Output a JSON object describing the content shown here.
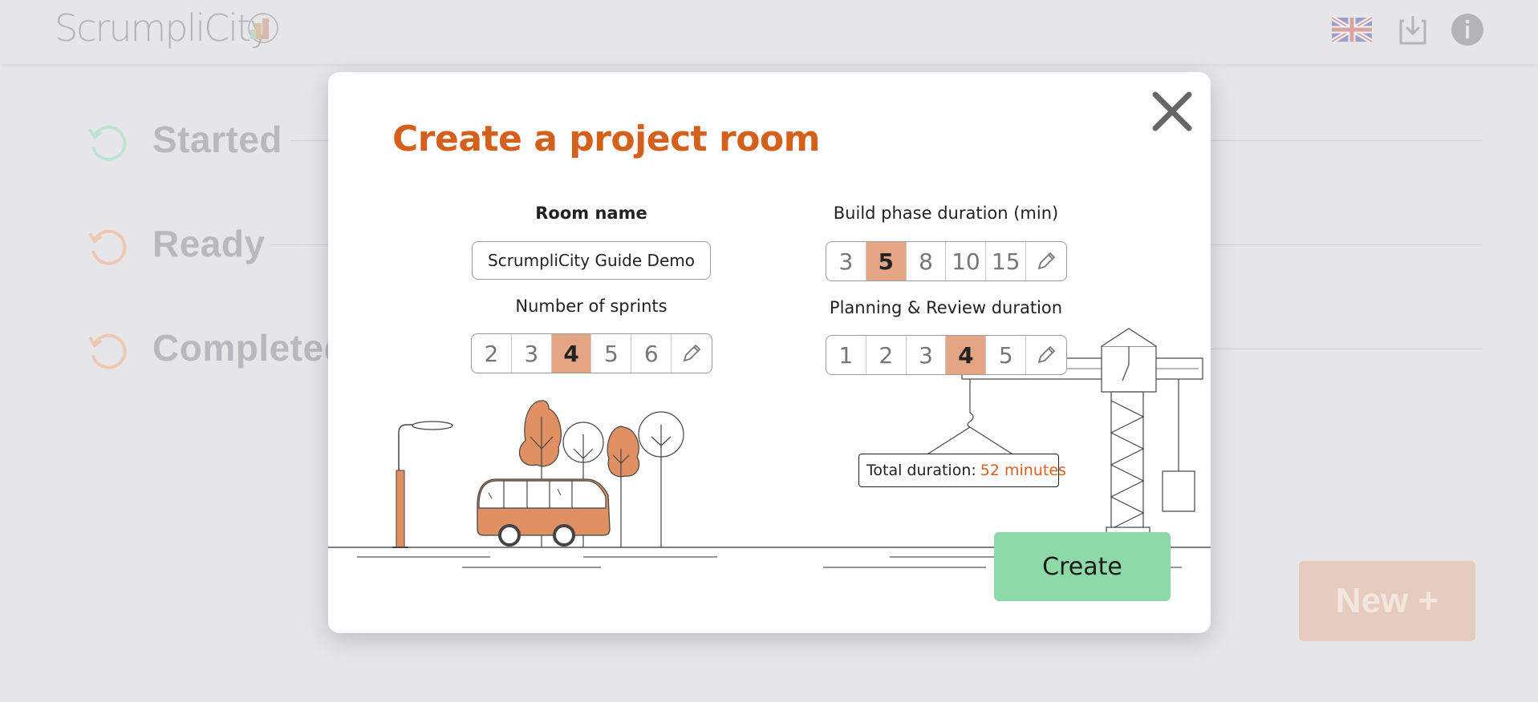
{
  "app": {
    "logo_text": "ScrumpliCity"
  },
  "header": {
    "icons": [
      "language-flag-icon",
      "download-icon",
      "info-icon"
    ]
  },
  "statuses": [
    {
      "label": "Started",
      "color": "#bfe3d2"
    },
    {
      "label": "Ready",
      "color": "#edc9b4"
    },
    {
      "label": "Completed",
      "color": "#edc9b4"
    }
  ],
  "new_button": {
    "label": "New +"
  },
  "modal": {
    "title": "Create a project room",
    "room_name": {
      "label": "Room name",
      "value": "ScrumpliCity Guide Demo"
    },
    "sprints": {
      "label": "Number of sprints",
      "options": [
        "2",
        "3",
        "4",
        "5",
        "6"
      ],
      "selected": "4"
    },
    "build_phase": {
      "label": "Build phase duration (min)",
      "options": [
        "3",
        "5",
        "8",
        "10",
        "15"
      ],
      "selected": "5"
    },
    "planning_review": {
      "label": "Planning & Review duration",
      "options": [
        "1",
        "2",
        "3",
        "4",
        "5"
      ],
      "selected": "4"
    },
    "total": {
      "label": "Total duration:",
      "value": "52 minutes"
    },
    "create_label": "Create"
  },
  "colors": {
    "accent": "#d4601e",
    "selected": "#e4a584",
    "create": "#8dd9a7"
  }
}
